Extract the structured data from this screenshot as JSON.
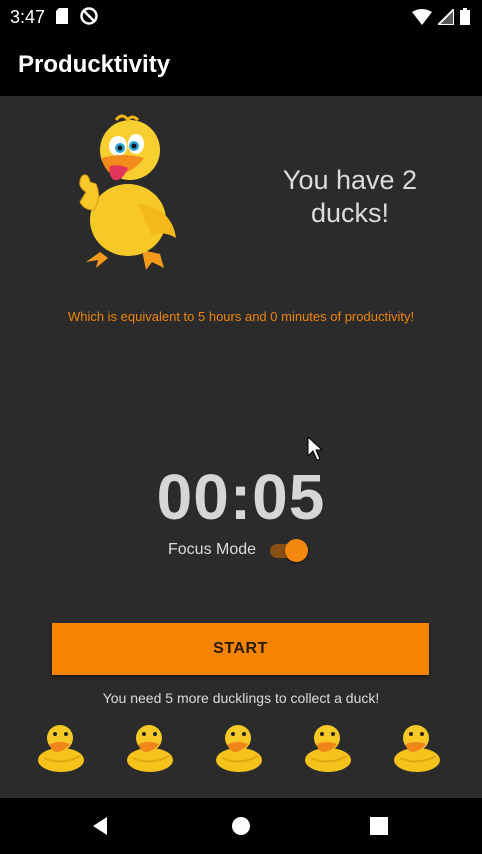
{
  "status_bar": {
    "time": "3:47",
    "icons_left": [
      "sd-card-icon",
      "do-not-disturb-icon"
    ],
    "icons_right": [
      "wifi-icon",
      "signal-icon",
      "battery-icon"
    ]
  },
  "app_bar": {
    "title": "Producktivity"
  },
  "hero": {
    "duck_image": "thumbs-up-duck-icon",
    "ducks_text": "You have 2 ducks!"
  },
  "equivalent_text": "Which is equivalent to 5 hours and 0 minutes of productivity!",
  "timer": {
    "display": "00:05"
  },
  "focus_mode": {
    "label": "Focus Mode",
    "enabled": true
  },
  "start_button": {
    "label": "START"
  },
  "ducklings": {
    "message": "You need 5 more ducklings to collect a duck!",
    "count": 5,
    "icon": "rubber-duck-icon"
  },
  "nav_bar": {
    "buttons": [
      "back-icon",
      "home-icon",
      "recents-icon"
    ]
  },
  "colors": {
    "background": "#2b2b2b",
    "bars": "#000000",
    "accent": "#f58400",
    "text": "#dcdcdc"
  }
}
